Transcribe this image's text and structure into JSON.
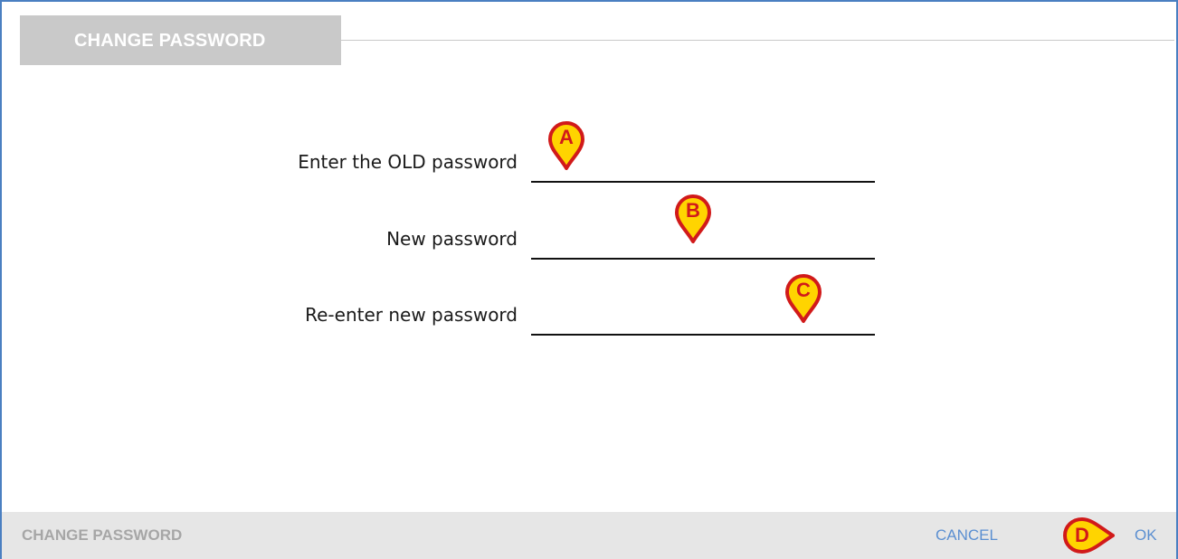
{
  "dialog": {
    "title": "CHANGE PASSWORD"
  },
  "form": {
    "old_password_label": "Enter the OLD password",
    "new_password_label": "New password",
    "reenter_password_label": "Re-enter new password",
    "old_password_value": "",
    "new_password_value": "",
    "reenter_password_value": ""
  },
  "markers": {
    "a": "A",
    "b": "B",
    "c": "C",
    "d": "D"
  },
  "footer": {
    "title": "CHANGE PASSWORD",
    "cancel_label": "CANCEL",
    "ok_label": "OK"
  },
  "colors": {
    "frame_border": "#4a7fc1",
    "title_tab_bg": "#c9c9c9",
    "footer_bg": "#e6e6e6",
    "footer_button_text": "#5b8fd1",
    "marker_fill": "#ffd400",
    "marker_outline": "#d11a1a"
  },
  "icons": {
    "marker": "map-pin-marker-icon",
    "marker_d": "arrow-marker-icon"
  }
}
